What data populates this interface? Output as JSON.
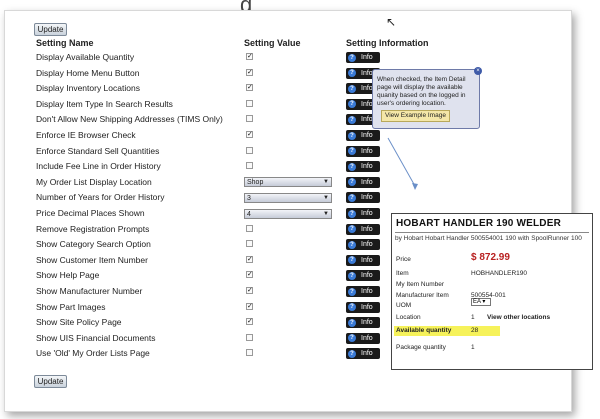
{
  "toolbar": {
    "update_top": "Update",
    "update_bottom": "Update"
  },
  "header": {
    "setting_name": "Setting Name",
    "setting_value": "Setting Value",
    "setting_information": "Setting Information"
  },
  "info_label": "Info",
  "info_glyph": "?",
  "page_title_fragment": "g",
  "cursor_glyph": "↖",
  "rows": [
    {
      "label": "Display Available Quantity",
      "type": "checkbox",
      "checked": true
    },
    {
      "label": "Display Home Menu Button",
      "type": "checkbox",
      "checked": true
    },
    {
      "label": "Display Inventory Locations",
      "type": "checkbox",
      "checked": true
    },
    {
      "label": "Display Item Type In Search Results",
      "type": "checkbox",
      "checked": false
    },
    {
      "label": "Don't Allow New Shipping Addresses (TIMS Only)",
      "type": "checkbox",
      "checked": false
    },
    {
      "label": "Enforce IE Browser Check",
      "type": "checkbox",
      "checked": true
    },
    {
      "label": "Enforce Standard Sell Quantities",
      "type": "checkbox",
      "checked": false
    },
    {
      "label": "Include Fee Line in Order History",
      "type": "checkbox",
      "checked": false
    },
    {
      "label": "My Order List Display Location",
      "type": "select",
      "value": "Shop"
    },
    {
      "label": "Number of Years for Order History",
      "type": "select",
      "value": "3"
    },
    {
      "label": "Price Decimal Places Shown",
      "type": "select",
      "value": "4"
    },
    {
      "label": "Remove Registration Prompts",
      "type": "checkbox",
      "checked": false
    },
    {
      "label": "Show Category Search Option",
      "type": "checkbox",
      "checked": false
    },
    {
      "label": "Show Customer Item Number",
      "type": "checkbox",
      "checked": true
    },
    {
      "label": "Show Help Page",
      "type": "checkbox",
      "checked": true
    },
    {
      "label": "Show Manufacturer Number",
      "type": "checkbox",
      "checked": true
    },
    {
      "label": "Show Part Images",
      "type": "checkbox",
      "checked": true
    },
    {
      "label": "Show Site Policy Page",
      "type": "checkbox",
      "checked": true
    },
    {
      "label": "Show UIS Financial Documents",
      "type": "checkbox",
      "checked": false
    },
    {
      "label": "Use 'Old' My Order Lists Page",
      "type": "checkbox",
      "checked": false
    }
  ],
  "tooltip": {
    "text": "When checked, the Item Detail page will display the available quanity based on the logged in user's ordering location.",
    "button": "View Example Image",
    "close": "×"
  },
  "product": {
    "title": "HOBART HANDLER 190 WELDER",
    "subtitle": "by Hobart Hobart Handler 500554001 190 with SpoolRunner 100",
    "price_label": "Price",
    "price_value": "$ 872.99",
    "item_label": "Item",
    "item_value": "HOBHANDLER190",
    "my_item_label": "My Item Number",
    "mfr_label": "Manufacturer Item",
    "mfr_value": "500554-001",
    "uom_label": "UOM",
    "uom_value": "EA",
    "location_label": "Location",
    "location_value": "1",
    "location_link": "View other locations",
    "avail_label": "Available quantity",
    "avail_value": "28",
    "package_label": "Package quantity",
    "package_value": "1",
    "highlight_color": "#f6f25a"
  },
  "colors": {
    "info_button": "#1a1a1a",
    "tooltip_bg": "#dfe2ee",
    "price": "#b82020"
  }
}
